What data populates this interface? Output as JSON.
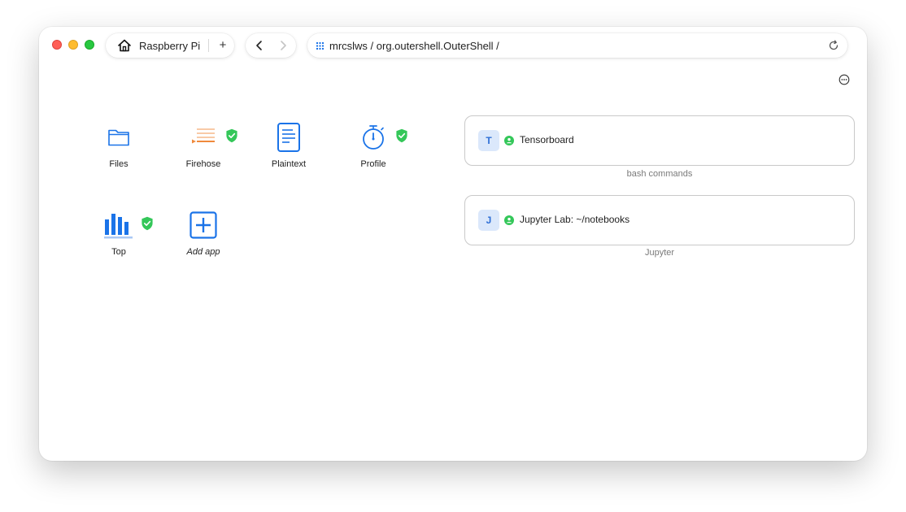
{
  "browser": {
    "tab_title": "Raspberry Pi",
    "new_tab_label": "+",
    "address": "mrcslws / org.outershell.OuterShell /"
  },
  "apps": [
    {
      "name": "Files",
      "icon": "folder-icon",
      "verified": false,
      "italic": false
    },
    {
      "name": "Firehose",
      "icon": "firehose-icon",
      "verified": true,
      "italic": false
    },
    {
      "name": "Plaintext",
      "icon": "document-icon",
      "verified": false,
      "italic": false
    },
    {
      "name": "Profile",
      "icon": "stopwatch-icon",
      "verified": true,
      "italic": false
    },
    {
      "name": "Top",
      "icon": "bar-chart-icon",
      "verified": true,
      "italic": false
    },
    {
      "name": "Add app",
      "icon": "add-square-icon",
      "verified": false,
      "italic": true
    }
  ],
  "sessions": [
    {
      "letter": "T",
      "title": "Tensorboard",
      "caption": "bash commands",
      "status_color": "#34c759"
    },
    {
      "letter": "J",
      "title": "Jupyter Lab: ~/notebooks",
      "caption": "Jupyter",
      "status_color": "#34c759"
    }
  ],
  "colors": {
    "accent_blue": "#1a73e8",
    "firehose_orange": "#f08a3c",
    "verified_green": "#34c759"
  }
}
